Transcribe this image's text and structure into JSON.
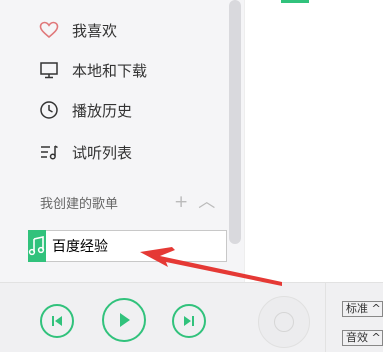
{
  "sidebar": {
    "items": [
      {
        "label": "我喜欢",
        "icon": "heart-icon"
      },
      {
        "label": "本地和下载",
        "icon": "monitor-icon"
      },
      {
        "label": "播放历史",
        "icon": "clock-icon"
      },
      {
        "label": "试听列表",
        "icon": "playlist-icon"
      }
    ],
    "section_title": "我创建的歌单",
    "add_symbol": "+",
    "collapse_symbol": "︿",
    "new_playlist_value": "百度经验"
  },
  "player": {
    "quality_label": "标准 ^",
    "effect_label": "音效 ^"
  },
  "colors": {
    "accent": "#31c27c",
    "heart": "#e0787a",
    "arrow": "#e53935"
  }
}
